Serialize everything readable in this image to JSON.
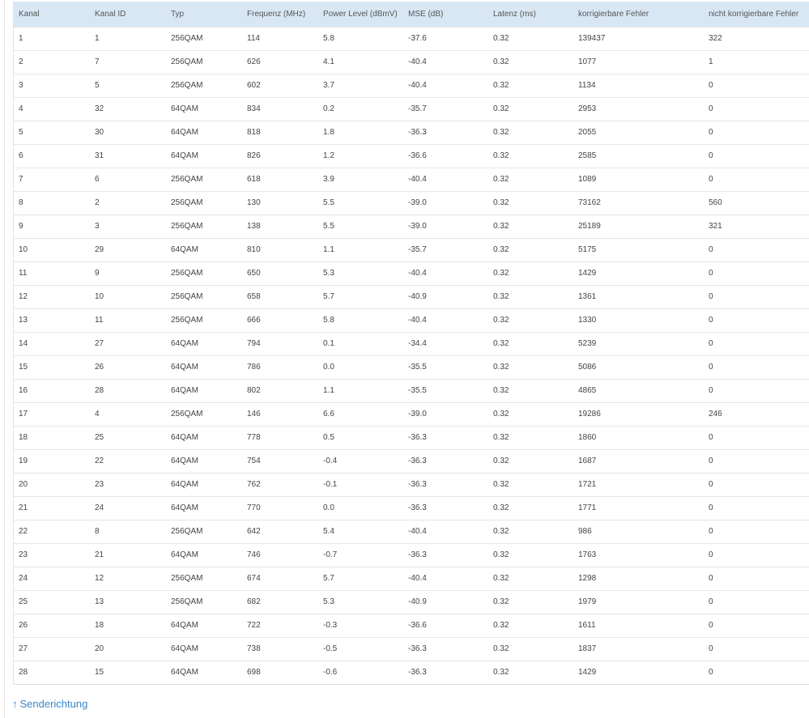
{
  "table": {
    "columns": [
      "Kanal",
      "Kanal ID",
      "Typ",
      "Frequenz (MHz)",
      "Power Level (dBmV)",
      "MSE (dB)",
      "Latenz (ms)",
      "korrigierbare Fehler",
      "nicht korrigierbare Fehler"
    ],
    "rows": [
      [
        "1",
        "1",
        "256QAM",
        "114",
        "5.8",
        "-37.6",
        "0.32",
        "139437",
        "322"
      ],
      [
        "2",
        "7",
        "256QAM",
        "626",
        "4.1",
        "-40.4",
        "0.32",
        "1077",
        "1"
      ],
      [
        "3",
        "5",
        "256QAM",
        "602",
        "3.7",
        "-40.4",
        "0.32",
        "1134",
        "0"
      ],
      [
        "4",
        "32",
        "64QAM",
        "834",
        "0.2",
        "-35.7",
        "0.32",
        "2953",
        "0"
      ],
      [
        "5",
        "30",
        "64QAM",
        "818",
        "1.8",
        "-36.3",
        "0.32",
        "2055",
        "0"
      ],
      [
        "6",
        "31",
        "64QAM",
        "826",
        "1.2",
        "-36.6",
        "0.32",
        "2585",
        "0"
      ],
      [
        "7",
        "6",
        "256QAM",
        "618",
        "3.9",
        "-40.4",
        "0.32",
        "1089",
        "0"
      ],
      [
        "8",
        "2",
        "256QAM",
        "130",
        "5.5",
        "-39.0",
        "0.32",
        "73162",
        "560"
      ],
      [
        "9",
        "3",
        "256QAM",
        "138",
        "5.5",
        "-39.0",
        "0.32",
        "25189",
        "321"
      ],
      [
        "10",
        "29",
        "64QAM",
        "810",
        "1.1",
        "-35.7",
        "0.32",
        "5175",
        "0"
      ],
      [
        "11",
        "9",
        "256QAM",
        "650",
        "5.3",
        "-40.4",
        "0.32",
        "1429",
        "0"
      ],
      [
        "12",
        "10",
        "256QAM",
        "658",
        "5.7",
        "-40.9",
        "0.32",
        "1361",
        "0"
      ],
      [
        "13",
        "11",
        "256QAM",
        "666",
        "5.8",
        "-40.4",
        "0.32",
        "1330",
        "0"
      ],
      [
        "14",
        "27",
        "64QAM",
        "794",
        "0.1",
        "-34.4",
        "0.32",
        "5239",
        "0"
      ],
      [
        "15",
        "26",
        "64QAM",
        "786",
        "0.0",
        "-35.5",
        "0.32",
        "5086",
        "0"
      ],
      [
        "16",
        "28",
        "64QAM",
        "802",
        "1.1",
        "-35.5",
        "0.32",
        "4865",
        "0"
      ],
      [
        "17",
        "4",
        "256QAM",
        "146",
        "6.6",
        "-39.0",
        "0.32",
        "19286",
        "246"
      ],
      [
        "18",
        "25",
        "64QAM",
        "778",
        "0.5",
        "-36.3",
        "0.32",
        "1860",
        "0"
      ],
      [
        "19",
        "22",
        "64QAM",
        "754",
        "-0.4",
        "-36.3",
        "0.32",
        "1687",
        "0"
      ],
      [
        "20",
        "23",
        "64QAM",
        "762",
        "-0.1",
        "-36.3",
        "0.32",
        "1721",
        "0"
      ],
      [
        "21",
        "24",
        "64QAM",
        "770",
        "0.0",
        "-36.3",
        "0.32",
        "1771",
        "0"
      ],
      [
        "22",
        "8",
        "256QAM",
        "642",
        "5.4",
        "-40.4",
        "0.32",
        "986",
        "0"
      ],
      [
        "23",
        "21",
        "64QAM",
        "746",
        "-0.7",
        "-36.3",
        "0.32",
        "1763",
        "0"
      ],
      [
        "24",
        "12",
        "256QAM",
        "674",
        "5.7",
        "-40.4",
        "0.32",
        "1298",
        "0"
      ],
      [
        "25",
        "13",
        "256QAM",
        "682",
        "5.3",
        "-40.9",
        "0.32",
        "1979",
        "0"
      ],
      [
        "26",
        "18",
        "64QAM",
        "722",
        "-0.3",
        "-36.6",
        "0.32",
        "1611",
        "0"
      ],
      [
        "27",
        "20",
        "64QAM",
        "738",
        "-0.5",
        "-36.3",
        "0.32",
        "1837",
        "0"
      ],
      [
        "28",
        "15",
        "64QAM",
        "698",
        "-0.6",
        "-36.3",
        "0.32",
        "1429",
        "0"
      ]
    ]
  },
  "footer": {
    "arrow_icon": "↑",
    "link_label": "Senderichtung"
  },
  "colors": {
    "header_bg": "#d9e7f5",
    "link": "#3a86c8"
  }
}
